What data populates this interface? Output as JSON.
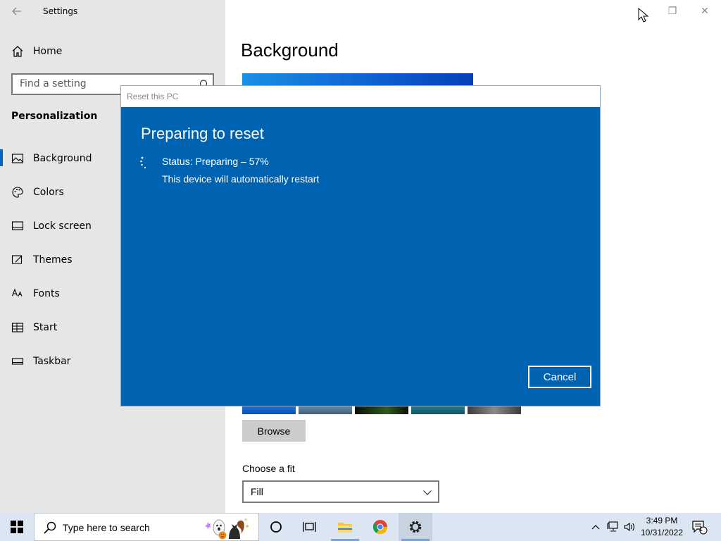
{
  "window": {
    "title": "Settings",
    "controls": {
      "minimize": "",
      "restore": "❐",
      "close": "✕"
    }
  },
  "sidebar": {
    "home_label": "Home",
    "search_placeholder": "Find a setting",
    "section_title": "Personalization",
    "items": [
      {
        "label": "Background",
        "icon": "picture-icon",
        "active": true
      },
      {
        "label": "Colors",
        "icon": "palette-icon"
      },
      {
        "label": "Lock screen",
        "icon": "lock-screen-icon"
      },
      {
        "label": "Themes",
        "icon": "themes-icon"
      },
      {
        "label": "Fonts",
        "icon": "fonts-icon"
      },
      {
        "label": "Start",
        "icon": "start-icon"
      },
      {
        "label": "Taskbar",
        "icon": "taskbar-icon"
      }
    ]
  },
  "main": {
    "title": "Background",
    "browse_label": "Browse",
    "fit_label": "Choose a fit",
    "fit_value": "Fill"
  },
  "dialog": {
    "window_title": "Reset this PC",
    "heading": "Preparing to reset",
    "status": "Status: Preparing – 57%",
    "progress_percent": 57,
    "restart_note": "This device will automatically restart",
    "cancel_label": "Cancel",
    "background_color": "#0063b1"
  },
  "taskbar": {
    "search_placeholder": "Type here to search",
    "pinned": [
      "cortana-icon",
      "task-view-icon",
      "file-explorer-icon",
      "chrome-icon",
      "settings-icon"
    ],
    "time": "3:49 PM",
    "date": "10/31/2022",
    "notification_count": "1"
  },
  "colors": {
    "accent": "#0067c0",
    "sidebar_bg": "#e6e6e6",
    "taskbar_bg": "#dce6f2"
  }
}
